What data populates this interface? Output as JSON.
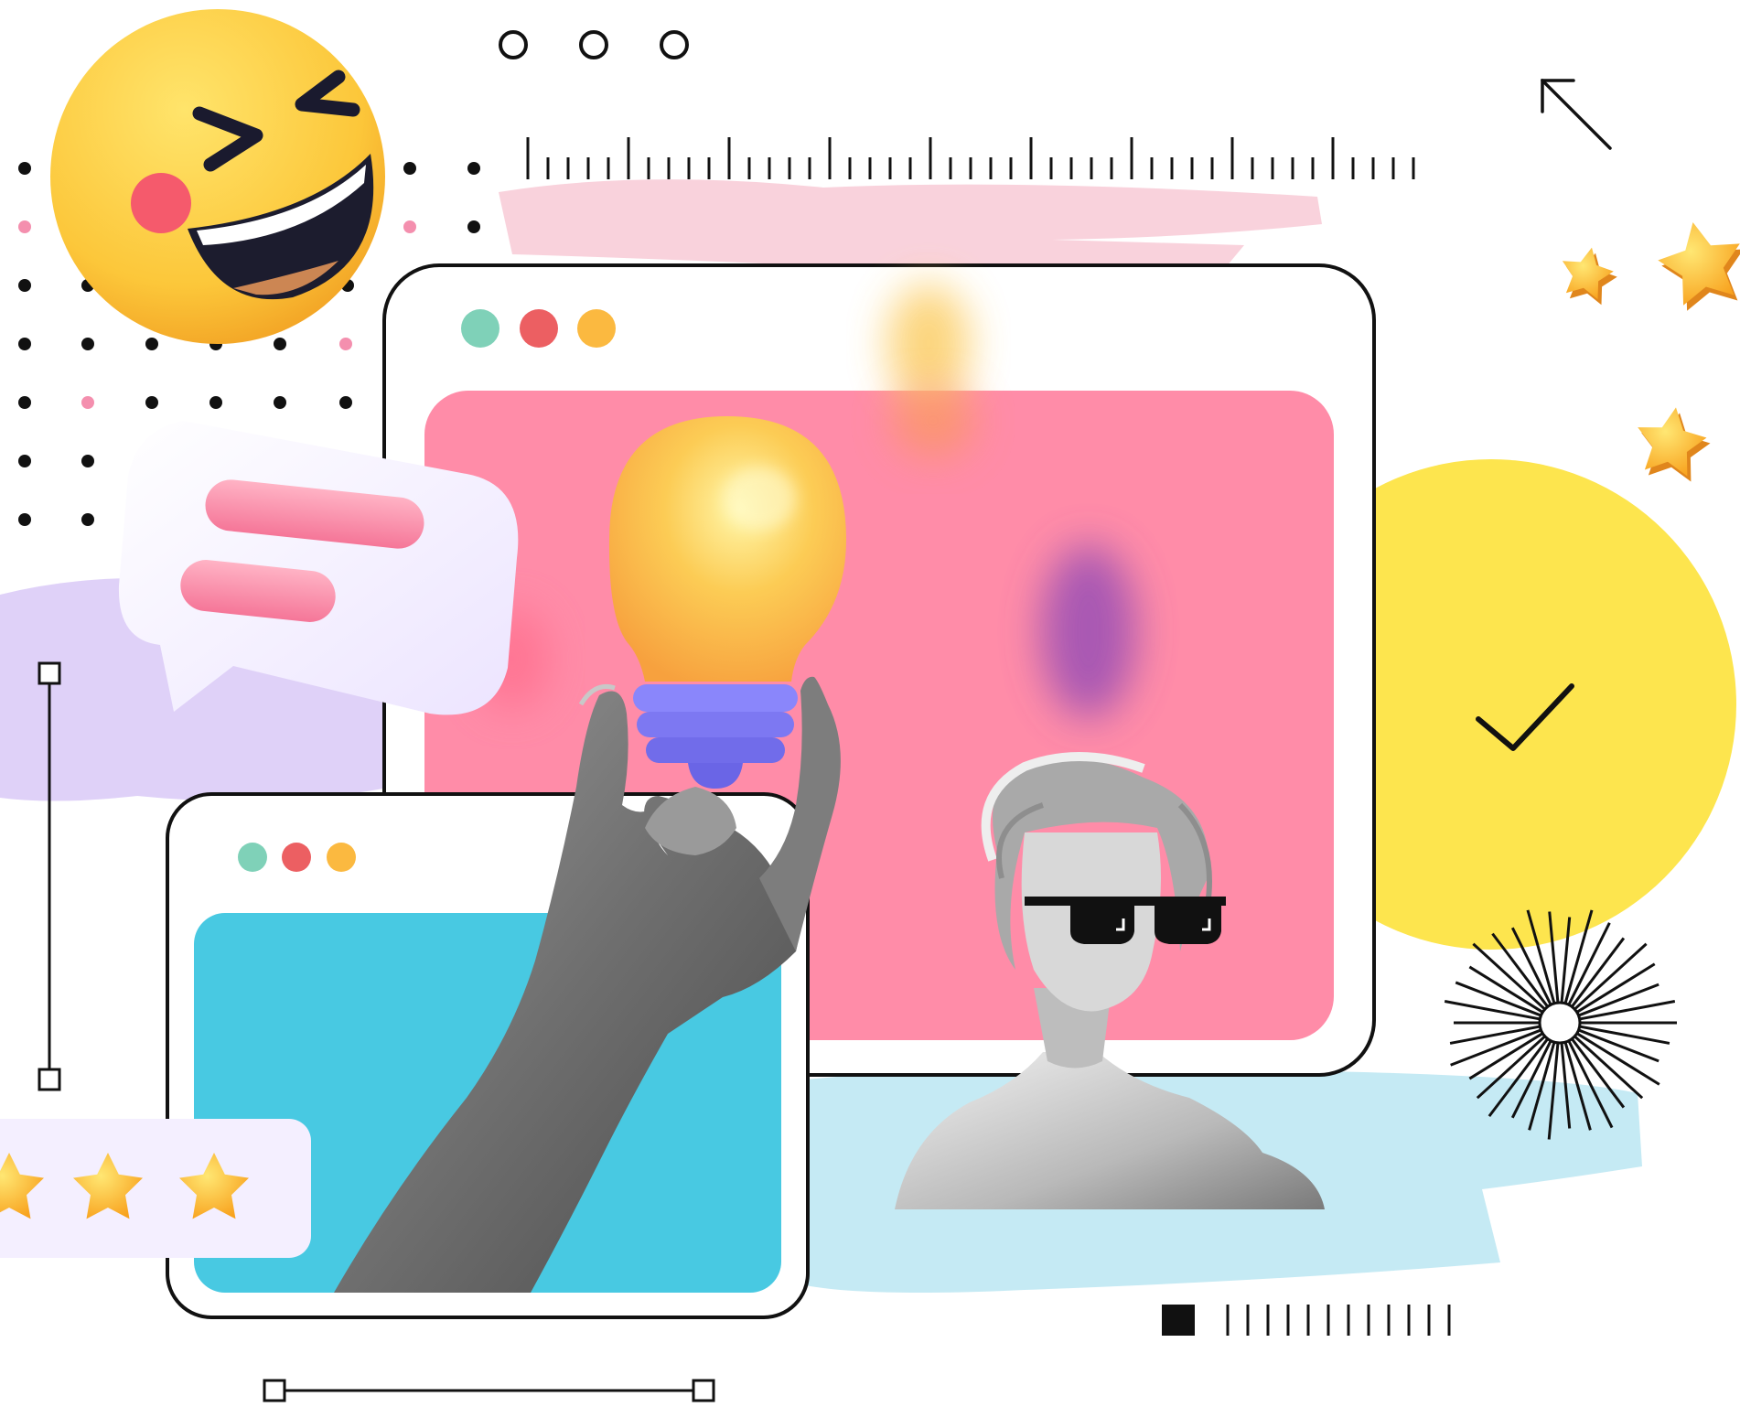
{
  "colors": {
    "background": "#ffffff",
    "outline": "#111111",
    "pink_screen": "#ff8ca8",
    "blue_screen": "#48c9e2",
    "yellow_circle": "#fde54e",
    "dot_green": "#7fd1b8",
    "dot_red": "#ec5f62",
    "dot_yellow": "#fbb940",
    "bulb": "#fcbb4a",
    "bulb_base": "#7f7ef5",
    "brush_pink": "#f8cad6",
    "brush_purple": "#d9c9f7",
    "brush_blue": "#bfe8f3",
    "dot_pink": "#f48fae"
  },
  "icons": {
    "emoji": "laughing-emoji-icon",
    "chat": "chat-bubble-icon",
    "check": "checkmark-icon",
    "arrow": "arrow-up-left-icon",
    "bulb": "lightbulb-icon",
    "sunburst": "sunburst-icon",
    "stars": "star-icon"
  },
  "rating": {
    "visible_stars": 3
  }
}
